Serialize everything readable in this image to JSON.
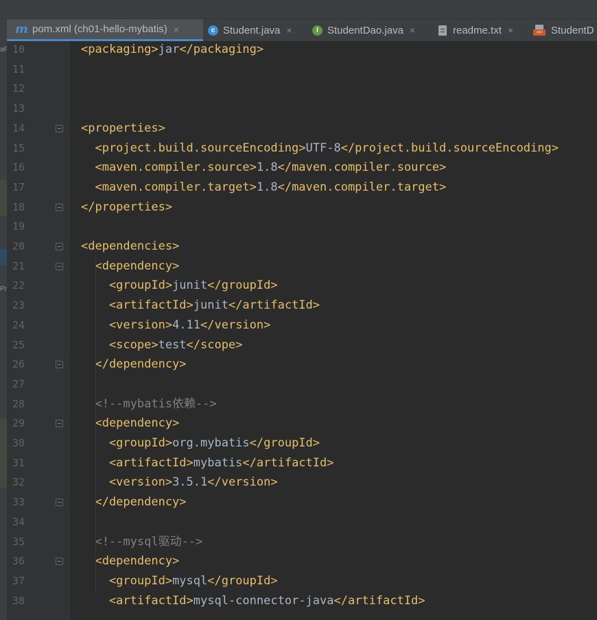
{
  "tabs": [
    {
      "label": "pom.xml (ch01-hello-mybatis)",
      "icon": "maven-icon",
      "active": true
    },
    {
      "label": "Student.java",
      "icon": "class-icon"
    },
    {
      "label": "StudentDao.java",
      "icon": "interface-icon"
    },
    {
      "label": "readme.txt",
      "icon": "text-file-icon"
    },
    {
      "label": "StudentD",
      "icon": "xml-file-icon"
    }
  ],
  "tab_close_glyph": "×",
  "icon_glyphs": {
    "maven": "m",
    "class": "c",
    "interface": "I",
    "xml": "<>"
  },
  "side_fragments": [
    "aP",
    "Pr"
  ],
  "colors": {
    "background": "#2b2b2b",
    "tag": "#e8bf6a",
    "text": "#a9b7c6",
    "comment": "#808080",
    "line_number": "#606366",
    "active_tab_underline": "#4a88c7"
  },
  "code_lines": [
    {
      "num": "10",
      "parts": [
        {
          "t": "<packaging>",
          "c": "tag"
        },
        {
          "t": "jar",
          "c": "txt"
        },
        {
          "t": "</packaging>",
          "c": "tag"
        }
      ]
    },
    {
      "num": "11",
      "parts": []
    },
    {
      "num": "12",
      "parts": []
    },
    {
      "num": "13",
      "parts": []
    },
    {
      "num": "14",
      "fold": true,
      "parts": [
        {
          "t": "<properties>",
          "c": "tag"
        }
      ]
    },
    {
      "num": "15",
      "parts": [
        {
          "t": "  <project.build.sourceEncoding>",
          "c": "tag"
        },
        {
          "t": "UTF-8",
          "c": "txt"
        },
        {
          "t": "</project.build.sourceEncoding>",
          "c": "tag"
        }
      ]
    },
    {
      "num": "16",
      "parts": [
        {
          "t": "  <maven.compiler.source>",
          "c": "tag"
        },
        {
          "t": "1.8",
          "c": "txt"
        },
        {
          "t": "</maven.compiler.source>",
          "c": "tag"
        }
      ]
    },
    {
      "num": "17",
      "parts": [
        {
          "t": "  <maven.compiler.target>",
          "c": "tag"
        },
        {
          "t": "1.8",
          "c": "txt"
        },
        {
          "t": "</maven.compiler.target>",
          "c": "tag"
        }
      ]
    },
    {
      "num": "18",
      "fold": true,
      "parts": [
        {
          "t": "</properties>",
          "c": "tag"
        }
      ]
    },
    {
      "num": "19",
      "parts": []
    },
    {
      "num": "20",
      "fold": true,
      "parts": [
        {
          "t": "<dependencies>",
          "c": "tag"
        }
      ]
    },
    {
      "num": "21",
      "fold": true,
      "parts": [
        {
          "t": "  <dependency>",
          "c": "tag"
        }
      ]
    },
    {
      "num": "22",
      "parts": [
        {
          "t": "    <groupId>",
          "c": "tag"
        },
        {
          "t": "junit",
          "c": "txt"
        },
        {
          "t": "</groupId>",
          "c": "tag"
        }
      ]
    },
    {
      "num": "23",
      "parts": [
        {
          "t": "    <artifactId>",
          "c": "tag"
        },
        {
          "t": "junit",
          "c": "txt"
        },
        {
          "t": "</artifactId>",
          "c": "tag"
        }
      ]
    },
    {
      "num": "24",
      "parts": [
        {
          "t": "    <version>",
          "c": "tag"
        },
        {
          "t": "4.11",
          "c": "txt"
        },
        {
          "t": "</version>",
          "c": "tag"
        }
      ]
    },
    {
      "num": "25",
      "parts": [
        {
          "t": "    <scope>",
          "c": "tag"
        },
        {
          "t": "test",
          "c": "txt"
        },
        {
          "t": "</scope>",
          "c": "tag"
        }
      ]
    },
    {
      "num": "26",
      "fold": true,
      "parts": [
        {
          "t": "  </dependency>",
          "c": "tag"
        }
      ]
    },
    {
      "num": "27",
      "parts": []
    },
    {
      "num": "28",
      "parts": [
        {
          "t": "  <!--mybatis依赖-->",
          "c": "cmt"
        }
      ]
    },
    {
      "num": "29",
      "fold": true,
      "parts": [
        {
          "t": "  <dependency>",
          "c": "tag"
        }
      ]
    },
    {
      "num": "30",
      "parts": [
        {
          "t": "    <groupId>",
          "c": "tag"
        },
        {
          "t": "org.mybatis",
          "c": "txt"
        },
        {
          "t": "</groupId>",
          "c": "tag"
        }
      ]
    },
    {
      "num": "31",
      "parts": [
        {
          "t": "    <artifactId>",
          "c": "tag"
        },
        {
          "t": "mybatis",
          "c": "txt"
        },
        {
          "t": "</artifactId>",
          "c": "tag"
        }
      ]
    },
    {
      "num": "32",
      "parts": [
        {
          "t": "    <version>",
          "c": "tag"
        },
        {
          "t": "3.5.1",
          "c": "txt"
        },
        {
          "t": "</version>",
          "c": "tag"
        }
      ]
    },
    {
      "num": "33",
      "fold": true,
      "parts": [
        {
          "t": "  </dependency>",
          "c": "tag"
        }
      ]
    },
    {
      "num": "34",
      "parts": []
    },
    {
      "num": "35",
      "parts": [
        {
          "t": "  <!--mysql驱动-->",
          "c": "cmt"
        }
      ]
    },
    {
      "num": "36",
      "fold": true,
      "parts": [
        {
          "t": "  <dependency>",
          "c": "tag"
        }
      ]
    },
    {
      "num": "37",
      "parts": [
        {
          "t": "    <groupId>",
          "c": "tag"
        },
        {
          "t": "mysql",
          "c": "txt"
        },
        {
          "t": "</groupId>",
          "c": "tag"
        }
      ]
    },
    {
      "num": "38",
      "parts": [
        {
          "t": "    <artifactId>",
          "c": "tag"
        },
        {
          "t": "mysql-connector-java",
          "c": "txt"
        },
        {
          "t": "</artifactId>",
          "c": "tag"
        }
      ]
    }
  ]
}
